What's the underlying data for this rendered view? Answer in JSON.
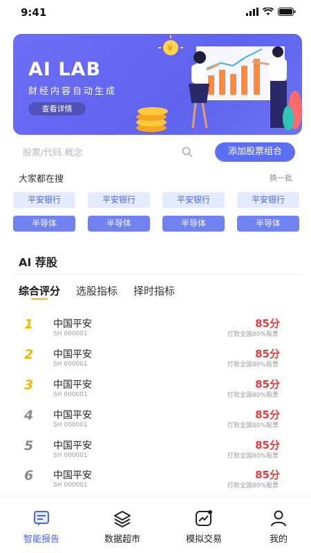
{
  "status": {
    "time": "9:41"
  },
  "banner": {
    "title": "AI LAB",
    "subtitle": "财经内容自动生成",
    "button": "查看详情"
  },
  "search": {
    "placeholder": "股票/代码.概念",
    "add_button": "添加股票组合"
  },
  "hot": {
    "title": "大家都在搜",
    "refresh": "换一批",
    "row1": [
      "平安银行",
      "平安银行",
      "平安银行",
      "平安银行"
    ],
    "row2": [
      "半导体",
      "半导体",
      "半导体",
      "半导体"
    ]
  },
  "ai": {
    "title": "AI 荐股",
    "tabs": [
      "综合评分",
      "选股指标",
      "择时指标"
    ],
    "stocks": [
      {
        "rank": "1",
        "name": "中国平安",
        "code": "SH 000001",
        "score": "85分",
        "beat": "打败全国80%股票"
      },
      {
        "rank": "2",
        "name": "中国平安",
        "code": "SH 000001",
        "score": "85分",
        "beat": "打败全国80%股票"
      },
      {
        "rank": "3",
        "name": "中国平安",
        "code": "SH 000001",
        "score": "85分",
        "beat": "打败全国80%股票"
      },
      {
        "rank": "4",
        "name": "中国平安",
        "code": "SH 000001",
        "score": "85分",
        "beat": "打败全国80%股票"
      },
      {
        "rank": "5",
        "name": "中国平安",
        "code": "SH 000001",
        "score": "85分",
        "beat": "打败全国80%股票"
      },
      {
        "rank": "6",
        "name": "中国平安",
        "code": "SH 000001",
        "score": "85分",
        "beat": "打败全国80%股票"
      }
    ]
  },
  "nav": [
    {
      "label": "智能报告",
      "icon": "report-icon",
      "active": true
    },
    {
      "label": "数据超市",
      "icon": "layers-icon",
      "active": false
    },
    {
      "label": "模拟交易",
      "icon": "chart-icon",
      "active": false
    },
    {
      "label": "我的",
      "icon": "user-icon",
      "active": false
    }
  ],
  "colors": {
    "accent": "#5b6ff3",
    "rank_gold": "#f5b800",
    "rank_gray": "#8a8a8a",
    "score_red": "#e63b3b"
  }
}
